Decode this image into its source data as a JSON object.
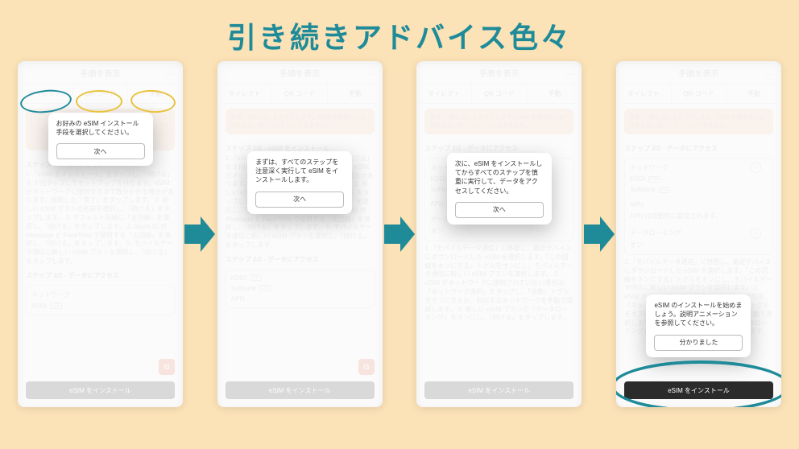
{
  "hero": {
    "title": "引き続きアドバイス色々"
  },
  "accent_teal": "#1f8b99",
  "phone_header": {
    "title": "手順を表示",
    "more": "…"
  },
  "tabs": {
    "direct": "ダイレクト",
    "qr": "QR コード",
    "manual": "手動"
  },
  "sections": {
    "step1": "ステップ 1/2 - eSIM をインストール",
    "step2": "ステップ 2/2 - データにアクセス"
  },
  "bottom_button": {
    "install": "eSIM をインストール"
  },
  "popups": {
    "p1": {
      "text": "お好みの eSIM インストール手段を選択してください。",
      "btn": "次へ"
    },
    "p2": {
      "text": "まずは、すべてのステップを注意深く実行して eSIM をインストールします。",
      "btn": "次へ"
    },
    "p3": {
      "text": "次に、eSIM をインストールしてからすべてのステップを慎重に実行して、データをアクセスしてください。",
      "btn": "次へ"
    },
    "p4": {
      "text": "eSIM のインストールを始めましょう。説明アニメーションを参照してください。",
      "btn": "分かりました"
    }
  },
  "warn": {
    "p1": "eSIM をインストールする際は、安心したインターネット接続環境が必要です。また、インストールプロセスを中断しないようにしてください。",
    "p23": "警告: 「閉じる」をタップします。eSIM を端末から削除すると、再インストールできません。"
  },
  "body": {
    "p1_steps": "1.「eSIM をインストール」をタップし、「続ける」を 3 回タップしてセットアップを待ちます。eSIM がネットワークに接続するまで数分かかる場合があります。接続した「完了」をタップします。\n2. 新しい eSIM プランの名前を選択し、「続ける」をタップします。\n3. デフォルト回線に「主回線」を選択し、「続ける」をタップします。\n4. Apple ID の iMessage と FaceTime で使用する「主回線」を選択し、「続ける」をタップします。\n5. モバイルデータ通信に新しい eSIM プランを選択し、「続ける」をタップします。",
    "p4_steps": "1.「モバイルデータ通信」に移動し、最近デバイスにダウンロードした eSIM を選択します。「この回線をオンにする」トグルをオンにし、モバイルデータ通信に新しい eSIM プランを選択します。\n2. eSIM がネットワークに接続されていない場合は、「ネットワーク選択」をタップし、「自動」トグルをオフにするか、対応するネットワークを手動で選択します。\n3. 新しい eSIM プランの「データローミング」をオンにし、「続ける」をタップします。"
  },
  "network": {
    "label": "ネットワーク",
    "kddi": "KDDI",
    "softbank": "Softbank",
    "lte": "LTE",
    "apn_label": "APN",
    "apn_auto": "APN は自動的に設定されます。",
    "roaming_label": "データローミング",
    "roaming_on": "オン"
  }
}
